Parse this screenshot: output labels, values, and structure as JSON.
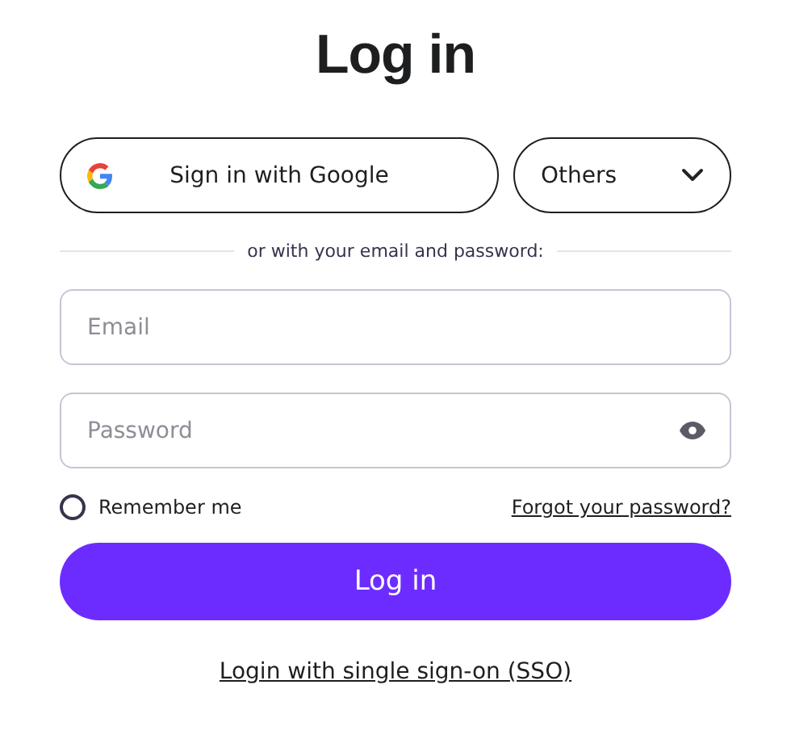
{
  "title": "Log in",
  "google_button": {
    "label": "Sign in with Google"
  },
  "others_dropdown": {
    "label": "Others"
  },
  "divider": "or with your email and password:",
  "email": {
    "placeholder": "Email"
  },
  "password": {
    "placeholder": "Password"
  },
  "remember": {
    "label": "Remember me",
    "checked": false
  },
  "forgot_link": "Forgot your password?",
  "login_button": "Log in",
  "sso_link": "Login with single sign-on (SSO)"
}
